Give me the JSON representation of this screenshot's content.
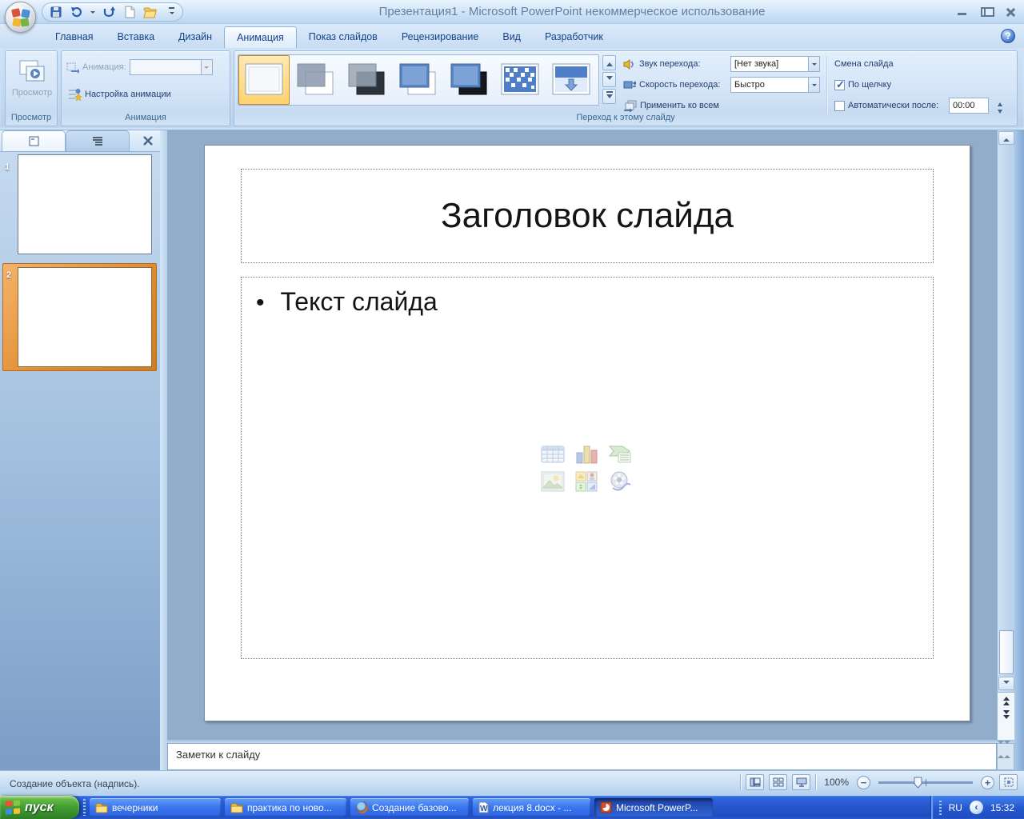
{
  "window": {
    "title": "Презентация1 - Microsoft PowerPoint некоммерческое использование",
    "quick_access_icons": [
      "save-icon",
      "undo-icon",
      "redo-icon",
      "new-document-icon",
      "open-icon",
      "customize-qat-icon"
    ],
    "help_label": "?"
  },
  "tabs": [
    {
      "label": "Главная",
      "active": false
    },
    {
      "label": "Вставка",
      "active": false
    },
    {
      "label": "Дизайн",
      "active": false
    },
    {
      "label": "Анимация",
      "active": true
    },
    {
      "label": "Показ слайдов",
      "active": false
    },
    {
      "label": "Рецензирование",
      "active": false
    },
    {
      "label": "Вид",
      "active": false
    },
    {
      "label": "Разработчик",
      "active": false
    }
  ],
  "ribbon": {
    "preview": {
      "button_label": "Просмотр",
      "group_label": "Просмотр"
    },
    "animation": {
      "field_label": "Анимация:",
      "field_value": "",
      "custom_button": "Настройка анимации",
      "group_label": "Анимация"
    },
    "transition": {
      "group_label": "Переход к этому слайду",
      "gallery_icons": [
        "no-transition",
        "fade-smoothly",
        "fade-through-black",
        "cut",
        "cut-through-black",
        "dissolve",
        "wipe-down"
      ],
      "selected_index": 0,
      "sound_label": "Звук перехода:",
      "sound_value": "[Нет звука]",
      "speed_label": "Скорость перехода:",
      "speed_value": "Быстро",
      "apply_all_label": "Применить ко всем",
      "advance_title": "Смена слайда",
      "on_click_label": "По щелчку",
      "on_click_checked": true,
      "auto_label": "Автоматически после:",
      "auto_checked": false,
      "auto_value": "00:00"
    }
  },
  "slides_panel": {
    "tab_icons": [
      "slides-tab-icon",
      "outline-tab-icon"
    ],
    "thumbnails": [
      {
        "number": "1",
        "selected": false
      },
      {
        "number": "2",
        "selected": true
      }
    ]
  },
  "slide": {
    "title": "Заголовок слайда",
    "bullet": "•",
    "body_text": "Текст слайда",
    "content_icons": [
      "insert-table-icon",
      "insert-chart-icon",
      "insert-smartart-icon",
      "insert-picture-icon",
      "insert-clipart-icon",
      "insert-media-icon"
    ]
  },
  "notes": {
    "placeholder": "Заметки к слайду"
  },
  "status_bar": {
    "message": "Создание объекта (надпись).",
    "view_icons": [
      "normal-view-icon",
      "slide-sorter-icon",
      "slideshow-icon"
    ],
    "zoom_value": "100%"
  },
  "taskbar": {
    "start_label": "пуск",
    "buttons": [
      {
        "label": "вечерники",
        "icon": "folder",
        "active": false
      },
      {
        "label": "практика по ново...",
        "icon": "folder",
        "active": false
      },
      {
        "label": "Создание базово...",
        "icon": "firefox",
        "active": false
      },
      {
        "label": "лекция 8.docx - ...",
        "icon": "word",
        "active": false
      },
      {
        "label": "Microsoft PowerP...",
        "icon": "powerpoint",
        "active": true
      }
    ],
    "tray": {
      "language": "RU",
      "time": "15:32"
    }
  }
}
